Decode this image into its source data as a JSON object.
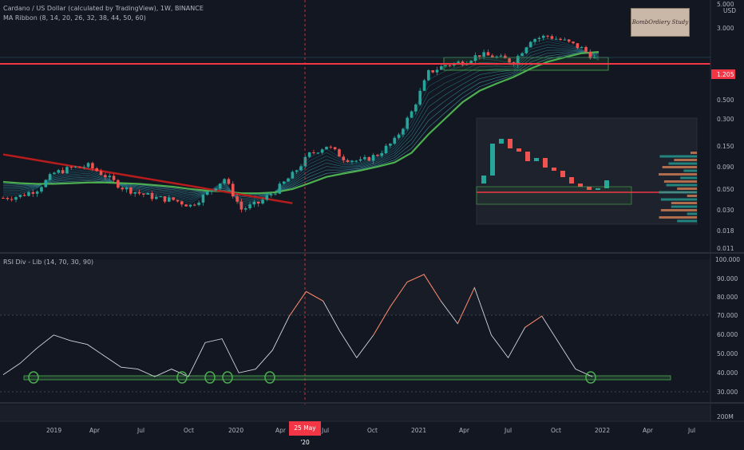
{
  "header": {
    "title": "Cardano / US Dollar (calculated by TradingView), 1W, BINANCE",
    "indicator": "MA Ribbon (8, 14, 20, 26, 32, 38, 44, 50, 60)",
    "rsi_label": "RSI Div - Lib (14, 70, 30, 90)"
  },
  "logo_text": "BombOrdiery Study",
  "price_currency": "USD",
  "price_axis": [
    "5.000",
    "3.000",
    "1.205",
    "0.500",
    "0.300",
    "0.150",
    "0.090",
    "0.050",
    "0.030",
    "0.018",
    "0.011"
  ],
  "rsi_axis": [
    "100.000",
    "90.000",
    "80.000",
    "70.000",
    "60.000",
    "50.000",
    "40.000",
    "30.000"
  ],
  "volume_axis": "200M",
  "current_price": "1.205",
  "x_axis": [
    "2019",
    "Apr",
    "Jul",
    "Oct",
    "2020",
    "Apr",
    "Jul",
    "Oct",
    "2021",
    "Apr",
    "Jul",
    "Oct",
    "2022",
    "Apr",
    "Jul"
  ],
  "crosshair_date": "25 May '20",
  "colors": {
    "background": "#131722",
    "up_candle": "#26a69a",
    "down_candle": "#ef5350",
    "resistance": "#f23645",
    "support": "#4caf50",
    "rsi_overbought": "#ff7a59",
    "rsi_normal": "#d1d4dc"
  },
  "chart_data": [
    {
      "type": "line",
      "title": "Cardano / US Dollar, 1W, BINANCE",
      "scale": "log",
      "ylim": [
        0.011,
        5.0
      ],
      "x": [
        "2019-01",
        "2019-02",
        "2019-03",
        "2019-04",
        "2019-05",
        "2019-06",
        "2019-07",
        "2019-08",
        "2019-09",
        "2019-10",
        "2019-11",
        "2019-12",
        "2020-01",
        "2020-02",
        "2020-03",
        "2020-04",
        "2020-05",
        "2020-06",
        "2020-07",
        "2020-08",
        "2020-09",
        "2020-10",
        "2020-11",
        "2020-12",
        "2021-01",
        "2021-02",
        "2021-03",
        "2021-04",
        "2021-05",
        "2021-06",
        "2021-07",
        "2021-08",
        "2021-09",
        "2021-10",
        "2021-11",
        "2021-12"
      ],
      "series": [
        {
          "name": "ADA close",
          "values": [
            0.04,
            0.042,
            0.05,
            0.075,
            0.085,
            0.09,
            0.07,
            0.052,
            0.045,
            0.04,
            0.038,
            0.033,
            0.045,
            0.065,
            0.03,
            0.035,
            0.048,
            0.072,
            0.12,
            0.15,
            0.11,
            0.1,
            0.12,
            0.17,
            0.35,
            0.95,
            1.15,
            1.25,
            1.5,
            1.4,
            1.25,
            2.2,
            2.4,
            2.1,
            1.75,
            1.25
          ]
        },
        {
          "name": "MA 60",
          "values": [
            0.06,
            0.058,
            0.057,
            0.057,
            0.058,
            0.059,
            0.059,
            0.058,
            0.057,
            0.055,
            0.053,
            0.05,
            0.048,
            0.047,
            0.045,
            0.045,
            0.046,
            0.05,
            0.058,
            0.068,
            0.074,
            0.08,
            0.088,
            0.098,
            0.125,
            0.2,
            0.3,
            0.45,
            0.6,
            0.72,
            0.85,
            1.05,
            1.25,
            1.4,
            1.55,
            1.6
          ]
        }
      ],
      "resistance_level": 1.205
    },
    {
      "type": "line",
      "title": "RSI Div - Lib (14, 70, 30, 90)",
      "ylim": [
        25,
        100
      ],
      "levels": [
        70,
        30,
        37
      ],
      "series": [
        {
          "name": "RSI",
          "values": [
            39,
            45,
            53,
            60,
            57,
            55,
            49,
            43,
            42,
            38,
            42,
            38,
            56,
            58,
            40,
            42,
            52,
            70,
            83,
            78,
            62,
            48,
            60,
            75,
            88,
            92,
            78,
            66,
            85,
            60,
            48,
            64,
            70,
            56,
            42,
            38
          ]
        }
      ],
      "oversold_touches": [
        "2019-01",
        "2019-10",
        "2019-12",
        "2020-01",
        "2020-03",
        "2021-12"
      ]
    }
  ]
}
